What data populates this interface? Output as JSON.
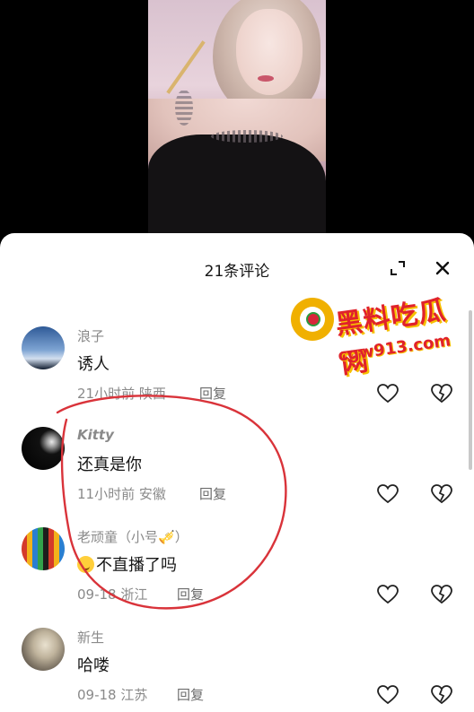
{
  "sheet": {
    "title": "21条评论"
  },
  "watermark": {
    "line1": "黑料吃瓜网",
    "line2": "cgw913.com"
  },
  "comments": [
    {
      "user": "浪子",
      "text": "诱人",
      "time": "21小时前",
      "location": "陕西",
      "reply": "回复"
    },
    {
      "user": "Kitty",
      "text": "还真是你",
      "time": "11小时前",
      "location": "安徽",
      "reply": "回复"
    },
    {
      "user": "老顽童（小号",
      "text": "不直播了吗",
      "time": "09-18",
      "location": "浙江",
      "reply": "回复",
      "name_suffix": "）"
    },
    {
      "user": "新生",
      "text": "哈喽",
      "time": "09-18",
      "location": "江苏",
      "reply": "回复"
    }
  ],
  "icons": {
    "expand": "expand-icon",
    "close": "close-icon",
    "like": "heart-outline-icon",
    "dislike": "broken-heart-icon"
  },
  "colors": {
    "annotation_circle": "#d9333a",
    "watermark_red": "#e0222b",
    "watermark_gold": "#f0b000"
  }
}
